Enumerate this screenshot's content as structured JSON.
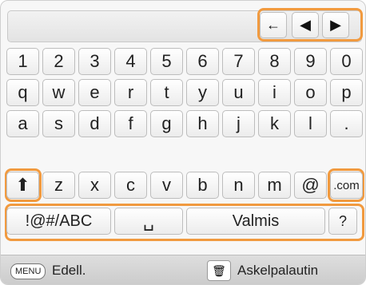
{
  "keyboard": {
    "row1": [
      "1",
      "2",
      "3",
      "4",
      "5",
      "6",
      "7",
      "8",
      "9",
      "0"
    ],
    "row2": [
      "q",
      "w",
      "e",
      "r",
      "t",
      "y",
      "u",
      "i",
      "o",
      "p"
    ],
    "row3": [
      "a",
      "s",
      "d",
      "f",
      "g",
      "h",
      "j",
      "k",
      "l",
      "."
    ],
    "row4": [
      "z",
      "x",
      "c",
      "v",
      "b",
      "n",
      "m",
      "@",
      ".com"
    ],
    "shift": "⬆",
    "mode": "!@#/ABC",
    "space": "␣",
    "done": "Valmis",
    "help": "?"
  },
  "nav": {
    "back": "←",
    "left": "◀",
    "right": "▶"
  },
  "bottom": {
    "menu_badge": "MENU",
    "menu_label": "Edell.",
    "trash_label": "Askelpalautin",
    "trash_icon": "🗑"
  },
  "colors": {
    "highlight": "#f19a3f"
  }
}
